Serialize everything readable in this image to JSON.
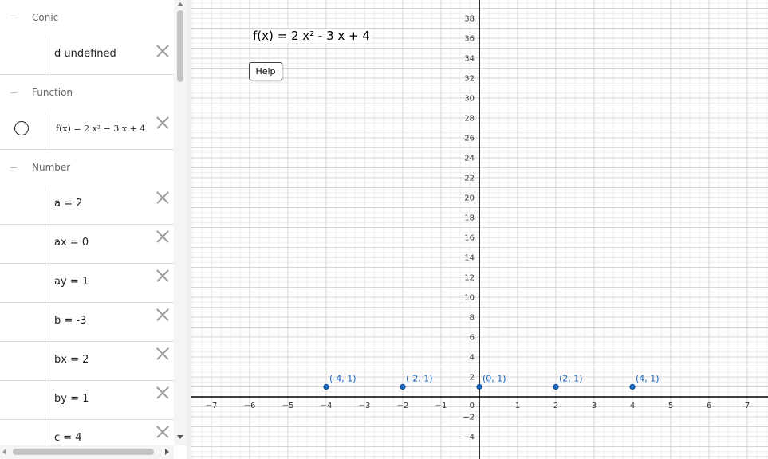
{
  "algebra_view": {
    "groups": {
      "conic": "Conic",
      "function": "Function",
      "number": "Number"
    },
    "items": {
      "d": "d undefined",
      "f": "f(x)  =  2 x² − 3 x + 4",
      "a": "a  =  2",
      "ax": "ax  =  0",
      "ay": "ay  =  1",
      "b": "b  =  -3",
      "bx": "bx  =  2",
      "by": "by  =  1",
      "c": "c  =  4"
    }
  },
  "graphics_view": {
    "function_text": "f(x) = 2 x² - 3 x + 4",
    "help_label": "Help"
  },
  "chart_data": {
    "type": "scatter",
    "x_ticks": [
      -7,
      -6,
      -5,
      -4,
      -3,
      -2,
      -1,
      1,
      2,
      3,
      4,
      5,
      6,
      7
    ],
    "y_ticks": [
      -4,
      -2,
      2,
      4,
      6,
      8,
      10,
      12,
      14,
      16,
      18,
      20,
      22,
      24,
      26,
      28,
      30,
      32,
      34,
      36,
      38
    ],
    "origin_label": "0",
    "xlim": [
      -7.5,
      7.5
    ],
    "ylim": [
      -6,
      39.8
    ],
    "grid": true,
    "point_color": "#1565c0",
    "points": [
      {
        "x": -4,
        "y": 1,
        "label": "(-4, 1)"
      },
      {
        "x": -2,
        "y": 1,
        "label": "(-2, 1)"
      },
      {
        "x": 0,
        "y": 1,
        "label": "(0, 1)"
      },
      {
        "x": 2,
        "y": 1,
        "label": "(2, 1)"
      },
      {
        "x": 4,
        "y": 1,
        "label": "(4, 1)"
      }
    ]
  }
}
